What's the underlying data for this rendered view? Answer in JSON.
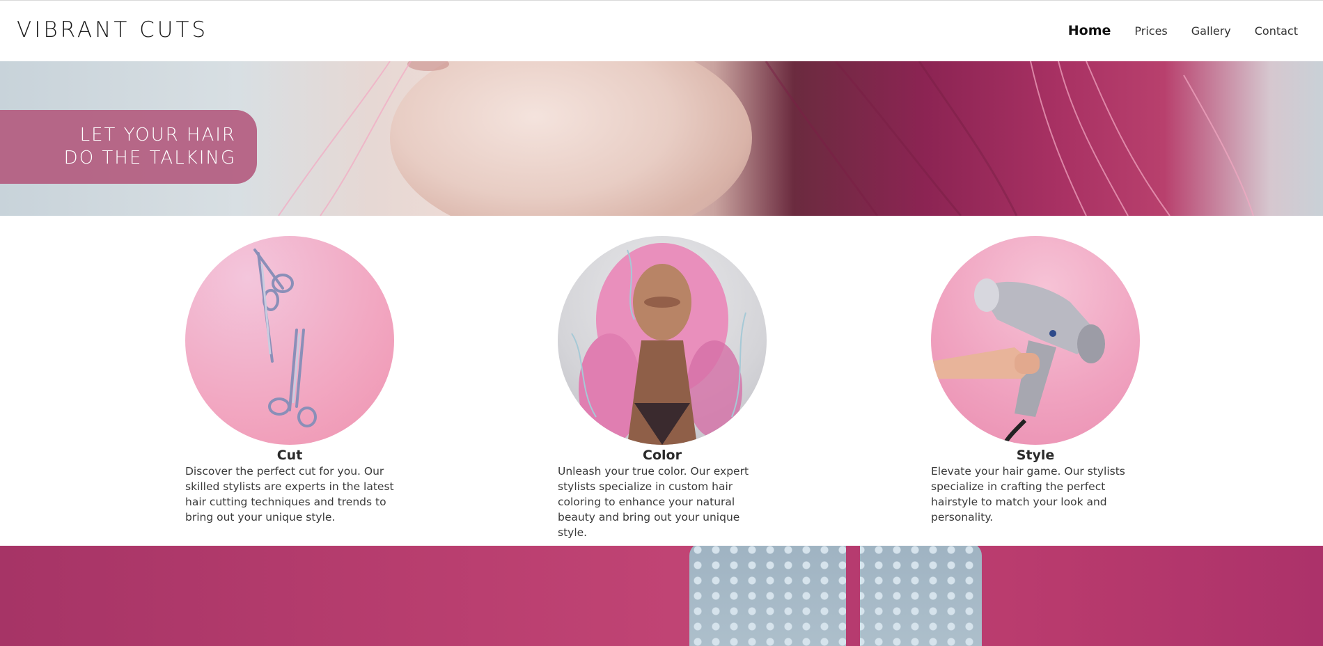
{
  "header": {
    "logo": "VIBRANT CUTS",
    "nav": [
      {
        "label": "Home",
        "active": true
      },
      {
        "label": "Prices",
        "active": false
      },
      {
        "label": "Gallery",
        "active": false
      },
      {
        "label": "Contact",
        "active": false
      }
    ]
  },
  "hero": {
    "tagline_line1": "LET YOUR HAIR",
    "tagline_line2": "DO THE TALKING"
  },
  "services": [
    {
      "title": "Cut",
      "description": "Discover the perfect cut for you. Our skilled stylists are experts in the latest hair cutting techniques and trends to bring out your unique style."
    },
    {
      "title": "Color",
      "description": "Unleash your true color. Our expert stylists specialize in custom hair coloring to enhance your natural beauty and bring out your unique style."
    },
    {
      "title": "Style",
      "description": "Elevate your hair game. Our stylists specialize in crafting the perfect hairstyle to match your look and personality."
    }
  ],
  "colors": {
    "banner": "#b2567b",
    "accent_pink": "#c24575",
    "text": "#333333"
  }
}
